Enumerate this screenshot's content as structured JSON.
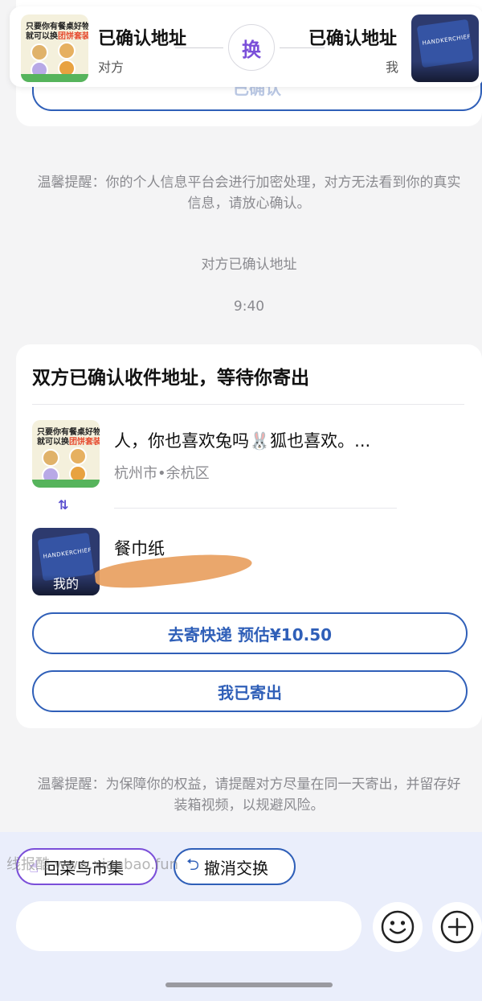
{
  "previous_card": {
    "button_label_partial": "已确认"
  },
  "header": {
    "left_status": "已确认地址",
    "left_party": "对方",
    "swap_label": "换",
    "right_status": "已确认地址",
    "right_party": "我",
    "left_thumb_text_1": "只要你有餐桌好物",
    "left_thumb_text_2_prefix": "就可以换",
    "left_thumb_text_2_highlight": "团饼套装",
    "right_thumb_label": "HANDKERCHIEF"
  },
  "system_messages": {
    "privacy_notice": "温馨提醒：你的个人信息平台会进行加密处理，对方无法看到你的真实信息，请放心确认。",
    "peer_confirmed": "对方已确认地址",
    "timestamp": "9:40",
    "shipping_notice": "温馨提醒：为保障你的权益，请提醒对方尽量在同一天寄出，并留存好装箱视频，以规避风险。"
  },
  "shipping_card": {
    "title": "双方已确认收件地址，等待你寄出",
    "peer_item_title": "人，你也喜欢兔吗🐰狐也喜欢。...",
    "peer_item_location": "杭州市•余杭区",
    "swap_arrows": "⇅",
    "my_item_title": "餐巾纸",
    "my_item_tag": "我的",
    "courier_button": "去寄快递 预估¥10.50",
    "shipped_button": "我已寄出"
  },
  "bottom_bar": {
    "quick_market_label": "回菜鸟市集",
    "quick_cancel_label": "撤消交换",
    "watermark": "线报酷 www.xianbao.fun",
    "input_placeholder": ""
  },
  "colors": {
    "accent_blue": "#2f5fb8",
    "accent_purple": "#7b4fd9",
    "background": "#f4f4f5",
    "bottom_background": "#eaeefb"
  }
}
